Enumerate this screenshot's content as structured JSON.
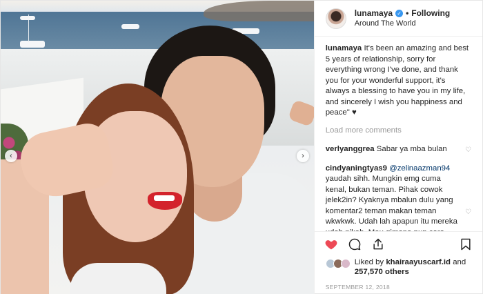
{
  "header": {
    "username": "lunamaya",
    "follow_status": "Following",
    "location": "Around The World",
    "separator": "•"
  },
  "caption": {
    "username": "lunamaya",
    "text": "It's been an amazing and best 5 years of relationship, sorry for everything wrong I've done, and thank you for your wonderful support, it's always a blessing to have you in my life, and sincerely I wish you happiness and peace\" ♥"
  },
  "load_more": "Load more comments",
  "comments": [
    {
      "username": "verlyanggrea",
      "text": "Sabar ya mba bulan"
    },
    {
      "username": "cindyaningtyas9",
      "mention": "@zelinaazman94",
      "text": "yaudah sihh. Mungkin emg cuma kenal, bukan teman. Pihak cowok jelek2in? Kyaknya mbalun dulu yang komentar2 teman makan teman wkwkwk. Udah lah apapun itu mereka udah nikah. Mau gimana pun cara dapatin jodoh nya, kalo sampe diikat dengan pernikahan, udah ada campur tangan Allah didalamnya"
    }
  ],
  "likes": {
    "prefix": "Liked by",
    "by_user": "khairaayuscarf.id",
    "conjunction": "and",
    "count": "257,570 others"
  },
  "date": "September 12, 2018",
  "colors": {
    "like_red": "#ed4956",
    "verified_blue": "#3897f0",
    "mention": "#003569"
  },
  "icons": [
    "heart-filled-icon",
    "comment-icon",
    "share-icon",
    "bookmark-icon",
    "verified-badge-icon",
    "chevron-left-icon",
    "chevron-right-icon",
    "heart-outline-icon"
  ]
}
